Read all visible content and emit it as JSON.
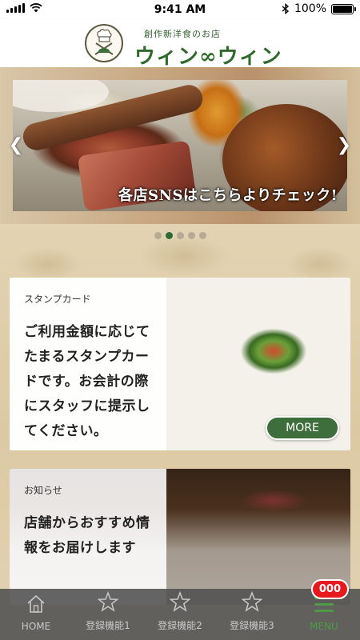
{
  "status_bar": {
    "time": "9:41 AM",
    "battery_text": "100%",
    "battery_level": 1.0
  },
  "header": {
    "tagline": "創作新洋食のお店",
    "shop_name": "ウィン∞ウィン"
  },
  "slider": {
    "caption": "各店SNSはこちらよりチェック!",
    "slide_count": 5,
    "active_index": 1
  },
  "cards": [
    {
      "label": "スタンプカード",
      "text": "ご利用金額に応じてたまるスタンプカードです。お会計の際にスタッフに提示してください。",
      "button": "MORE"
    },
    {
      "label": "お知らせ",
      "text": "店舗からおすすめ情報をお届けします"
    }
  ],
  "tab_bar": {
    "items": [
      {
        "label": "HOME",
        "icon": "home-icon"
      },
      {
        "label": "登録機能1",
        "icon": "star-icon"
      },
      {
        "label": "登録機能2",
        "icon": "star-icon"
      },
      {
        "label": "登録機能3",
        "icon": "star-icon"
      },
      {
        "label": "MENU",
        "icon": "menu-icon",
        "badge": "000"
      }
    ]
  },
  "colors": {
    "brand_green": "#2f6a2a",
    "accent_green": "#3d6e3c",
    "badge_red": "#e8191e"
  }
}
